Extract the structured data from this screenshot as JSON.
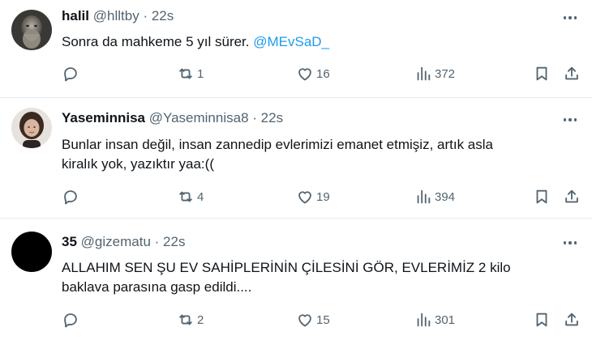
{
  "tweets": [
    {
      "name": "halil",
      "handle": "@hlltby",
      "dot": "·",
      "time": "22s",
      "text_parts": [
        "Sonra da mahkeme 5 yıl sürer. ",
        "@MEvSaD_"
      ],
      "replies": "",
      "retweets": "1",
      "likes": "16",
      "views": "372"
    },
    {
      "name": "Yaseminnisa",
      "handle": "@Yaseminnisa8",
      "dot": "·",
      "time": "22s",
      "text_lines": [
        "Bunlar insan değil, insan zannedip evlerimizi emanet etmişiz, artık asla",
        "kiralık yok, yazıktır  yaa:(("
      ],
      "replies": "",
      "retweets": "4",
      "likes": "19",
      "views": "394"
    },
    {
      "name": "35",
      "handle": "@gizematu",
      "dot": "·",
      "time": "22s",
      "text_lines": [
        "ALLAHIM SEN ŞU EV SAHİPLERİNİN ÇİLESİNİ GÖR, EVLERİMİZ 2 kilo",
        "baklava parasına gasp edildi...."
      ],
      "replies": "",
      "retweets": "2",
      "likes": "15",
      "views": "301"
    }
  ],
  "colors": {
    "text": "#0f1419",
    "secondary": "#536471",
    "link": "#1d9bf0",
    "divider": "#e6eaee"
  },
  "icons": [
    "reply-icon",
    "retweet-icon",
    "like-icon",
    "views-icon",
    "bookmark-icon",
    "share-icon",
    "more-icon"
  ]
}
